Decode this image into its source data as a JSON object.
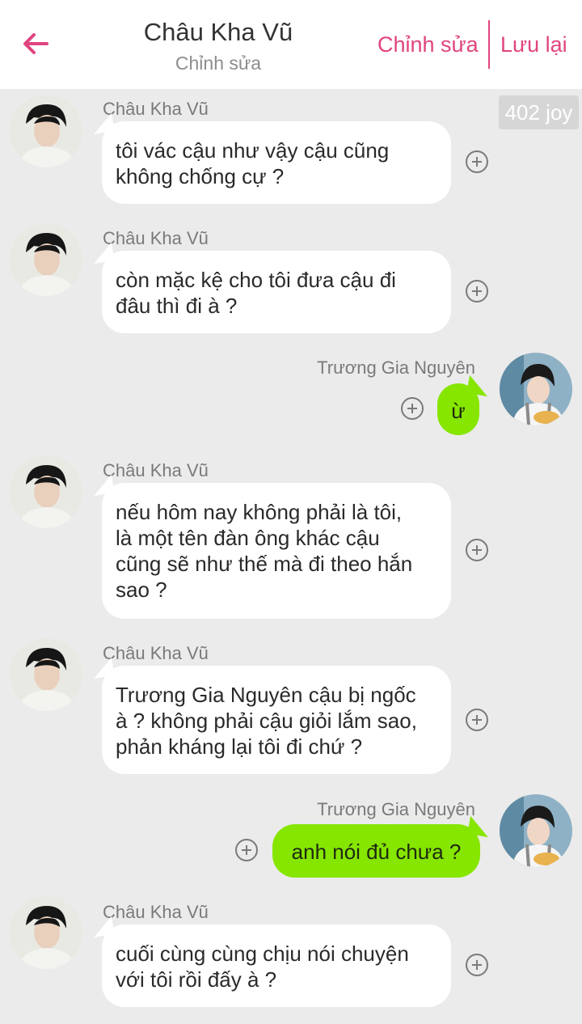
{
  "header": {
    "title": "Châu Kha Vũ",
    "subtitle": "Chỉnh sửa",
    "edit_label": "Chỉnh sửa",
    "save_label": "Lưu lại",
    "back_icon": "arrow-left-icon",
    "accent_color": "#e0457f"
  },
  "badge": {
    "text": "402 joy"
  },
  "messages": [
    {
      "sender": "Châu Kha Vũ",
      "side": "left",
      "lines": [
        "tôi vác cậu như vậy cậu cũng",
        "không chống cự ?"
      ]
    },
    {
      "sender": "Châu Kha Vũ",
      "side": "left",
      "lines": [
        "còn mặc kệ cho tôi đưa cậu đi",
        "đâu thì đi à ?"
      ]
    },
    {
      "sender": "Trương Gia Nguyên",
      "side": "right",
      "lines": [
        "ừ"
      ]
    },
    {
      "sender": "Châu Kha Vũ",
      "side": "left",
      "lines": [
        "nếu hôm nay không phải là tôi,",
        "là một tên đàn ông khác cậu",
        "cũng sẽ như thế mà đi theo hắn",
        "sao ?"
      ]
    },
    {
      "sender": "Châu Kha Vũ",
      "side": "left",
      "lines": [
        "Trương Gia Nguyên cậu bị ngốc",
        "à ? không phải cậu giỏi lắm sao,",
        "phản kháng lại tôi đi chứ ?"
      ]
    },
    {
      "sender": "Trương Gia Nguyên",
      "side": "right",
      "lines": [
        "anh nói đủ chưa ?"
      ]
    },
    {
      "sender": "Châu Kha Vũ",
      "side": "left",
      "lines": [
        "cuối cùng cùng chịu nói chuyện",
        "với tôi rồi đấy à ?"
      ]
    }
  ],
  "colors": {
    "background": "#ebebeb",
    "left_bubble": "#ffffff",
    "right_bubble": "#86e600"
  }
}
